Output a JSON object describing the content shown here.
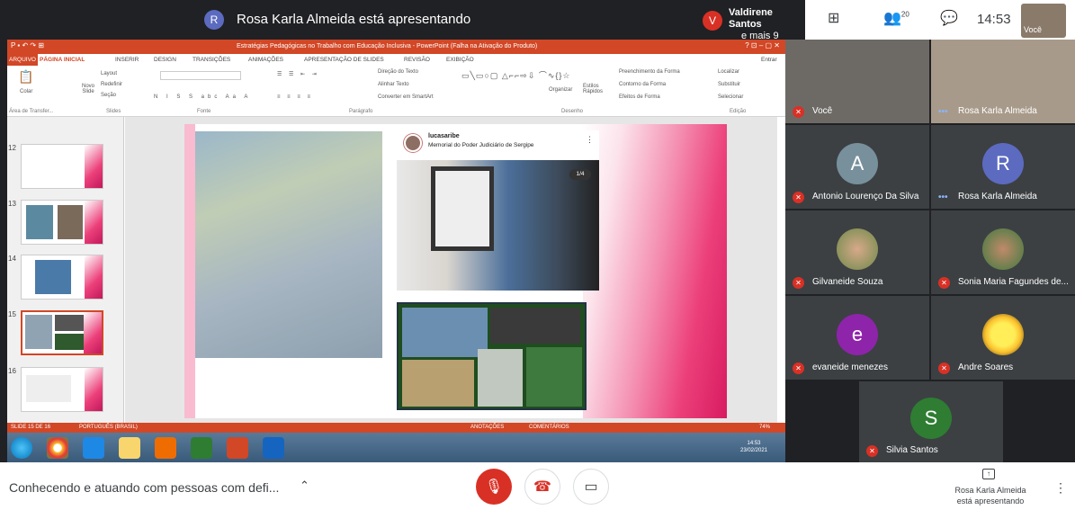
{
  "topbar": {
    "presenter_initial": "R",
    "presenter_title": "Rosa Karla Almeida está apresentando",
    "others_initial": "V",
    "others_name": "Valdirene Santos",
    "others_more": "e mais 9",
    "participants_count": "20",
    "clock": "14:53",
    "self_label": "Você"
  },
  "powerpoint": {
    "window_title": "Estratégias Pedagógicas no Trabalho com Educação Inclusiva - PowerPoint (Falha na Ativação do Produto)",
    "tabs": [
      "ARQUIVO",
      "PÁGINA INICIAL",
      "INSERIR",
      "DESIGN",
      "TRANSIÇÕES",
      "ANIMAÇÕES",
      "APRESENTAÇÃO DE SLIDES",
      "REVISÃO",
      "EXIBIÇÃO"
    ],
    "signin": "Entrar",
    "ribbon": {
      "paste": "Colar",
      "new_slide": "Novo Slide",
      "layout": "Layout",
      "reset": "Redefinir",
      "section": "Seção",
      "group_clipboard": "Área de Transfer...",
      "group_slides": "Slides",
      "group_font": "Fonte",
      "group_paragraph": "Parágrafo",
      "text_direction": "Direção do Texto",
      "align_text": "Alinhar Texto",
      "convert_smartart": "Converter em SmartArt",
      "organize": "Organizar",
      "quick_styles": "Estilos Rápidos",
      "shape_fill": "Preenchimento da Forma",
      "shape_outline": "Contorno da Forma",
      "shape_effects": "Efeitos de Forma",
      "group_drawing": "Desenho",
      "find": "Localizar",
      "replace": "Substituir",
      "select": "Selecionar",
      "group_editing": "Edição"
    },
    "thumbnail_numbers": [
      "12",
      "13",
      "14",
      "15",
      "16"
    ],
    "slide_post": {
      "user": "lucasaribe",
      "location": "Memorial do Poder Judiciário de Sergipe",
      "counter": "1/4"
    },
    "statusbar": {
      "slide_info": "SLIDE 15 DE 16",
      "language": "PORTUGUÊS (BRASIL)",
      "notes": "ANOTAÇÕES",
      "comments": "COMENTÁRIOS",
      "zoom": "74%"
    },
    "tray": {
      "time": "14:53",
      "date": "23/02/2021"
    }
  },
  "participants": [
    {
      "name": "Você",
      "state": "muted"
    },
    {
      "name": "Rosa Karla Almeida",
      "state": "speaking"
    },
    {
      "name": "Antonio Lourenço Da Silva",
      "initial": "A",
      "state": "muted",
      "color": "#78909c"
    },
    {
      "name": "Rosa Karla Almeida",
      "initial": "R",
      "state": "speaking",
      "color": "#5c6bc0"
    },
    {
      "name": "Gilvaneide Souza",
      "state": "muted"
    },
    {
      "name": "Sonia Maria Fagundes de...",
      "state": "muted"
    },
    {
      "name": "evaneide menezes",
      "initial": "e",
      "state": "muted",
      "color": "#8e24aa"
    },
    {
      "name": "Andre Soares",
      "state": "muted"
    },
    {
      "name": "Silvia Santos",
      "initial": "S",
      "state": "muted",
      "color": "#2e7d32"
    }
  ],
  "bottom": {
    "meeting_name": "Conhecendo e atuando com pessoas com defi...",
    "presenting_line1": "Rosa Karla Almeida",
    "presenting_line2": "está apresentando"
  },
  "colors": {
    "accent_red": "#d93025",
    "powerpoint_orange": "#d24726",
    "meet_dark": "#202124"
  }
}
